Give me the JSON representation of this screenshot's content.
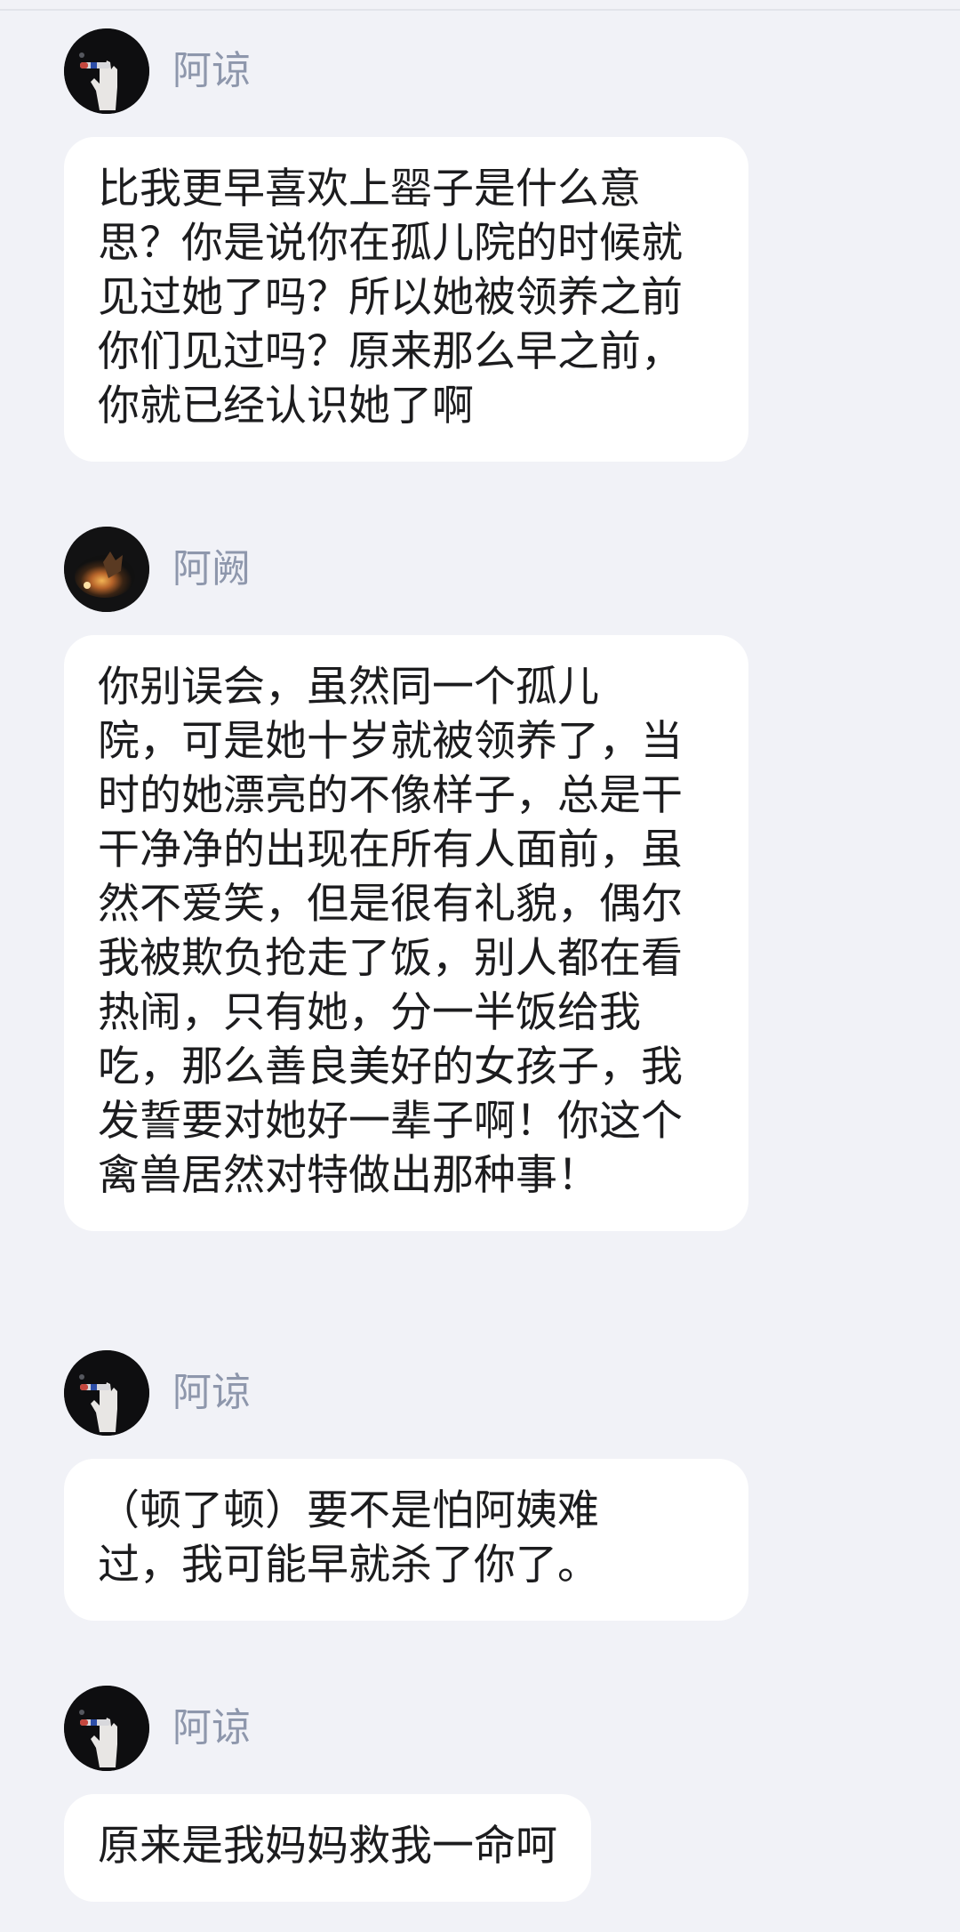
{
  "messages": [
    {
      "sender": "阿谅",
      "avatar": "hand-holding-cigarette-avatar",
      "text": "比我更早喜欢上罂子是什么意思？你是说你在孤儿院的时候就见过她了吗？所以她被领养之前你们见过吗？原来那么早之前，你就已经认识她了啊"
    },
    {
      "sender": "阿阙",
      "avatar": "fire-in-dark-avatar",
      "text": "你别误会，虽然同一个孤儿\n院，可是她十岁就被领养了，当时的她漂亮的不像样子，总是干干净净的出现在所有人面前，虽然不爱笑，但是很有礼貌，偶尔我被欺负抢走了饭，别人都在看热闹，只有她，分一半饭给我吃，那么善良美好的女孩子，我发誓要对她好一辈子啊！你这个禽兽居然对特做出那种事！"
    },
    {
      "sender": "阿谅",
      "avatar": "hand-holding-cigarette-avatar",
      "text": "（顿了顿）要不是怕阿姨难\n过，我可能早就杀了你了。"
    },
    {
      "sender": "阿谅",
      "avatar": "hand-holding-cigarette-avatar",
      "text": "原来是我妈妈救我一命呵"
    }
  ]
}
